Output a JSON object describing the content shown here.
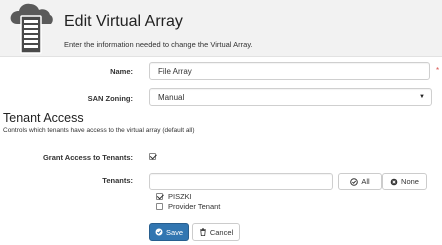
{
  "header": {
    "title": "Edit Virtual Array",
    "subtitle": "Enter the information needed to change the Virtual Array."
  },
  "form": {
    "name_label": "Name:",
    "name_value": "File Array",
    "required_mark": "*",
    "san_label": "SAN Zoning:",
    "san_value": "Manual"
  },
  "tenant_section": {
    "title": "Tenant Access",
    "description": "Controls which tenants have access to the virtual array (default all)",
    "grant_label": "Grant Access to Tenants:",
    "grant_checked": true,
    "tenants_label": "Tenants:",
    "filter_value": "",
    "all_label": "All",
    "none_label": "None",
    "tenants": [
      {
        "label": "PISZKI",
        "checked": true
      },
      {
        "label": "Provider Tenant",
        "checked": false
      }
    ]
  },
  "actions": {
    "save_label": "Save",
    "cancel_label": "Cancel"
  },
  "colors": {
    "primary": "#3276b1",
    "required": "#d9534f",
    "header_bg": "#f2f2f2"
  }
}
